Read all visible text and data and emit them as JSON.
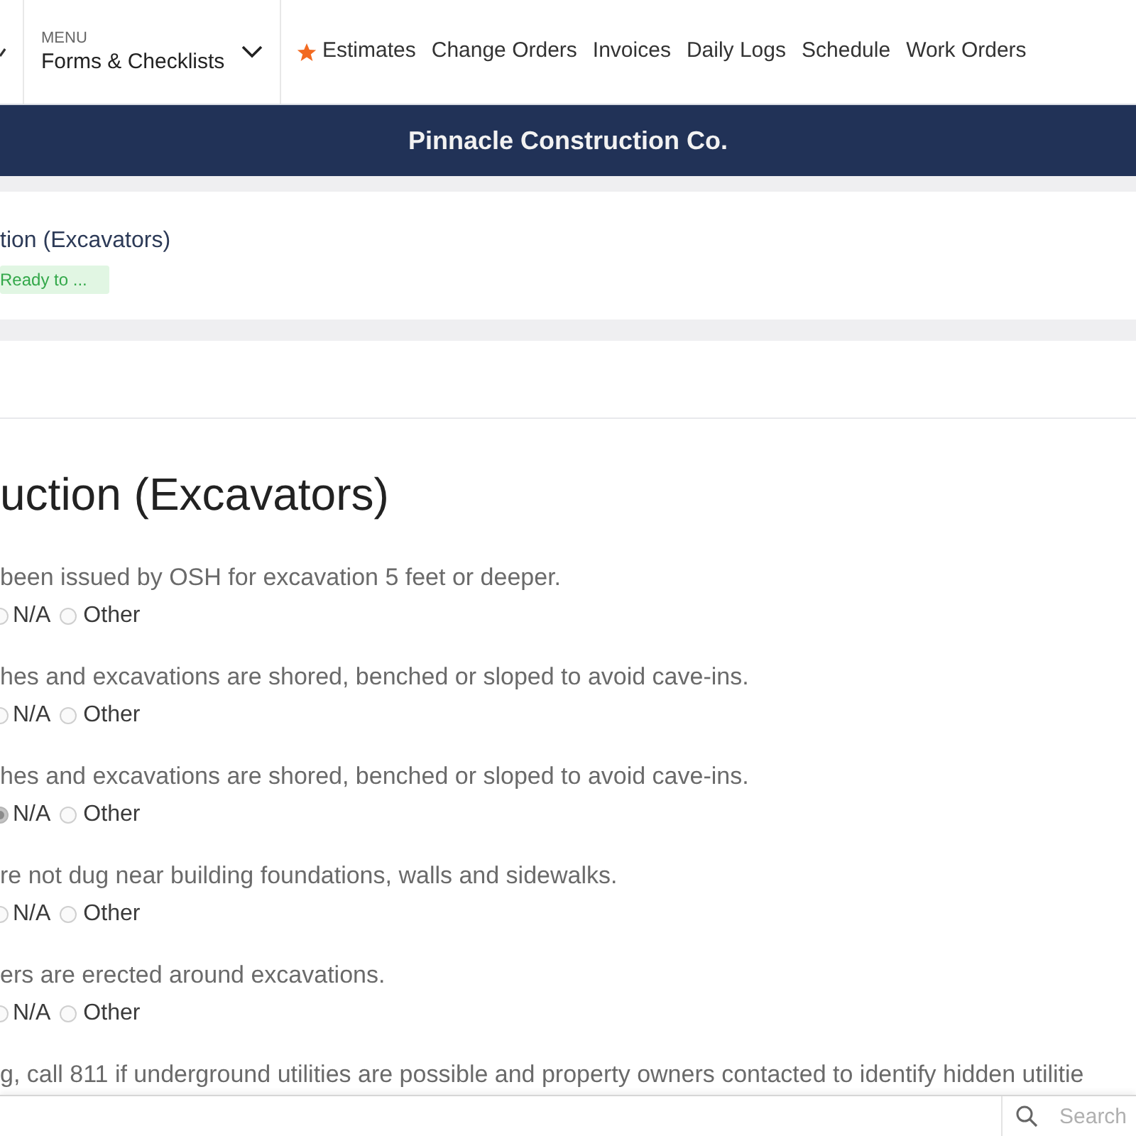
{
  "nav": {
    "menu": {
      "caption": "MENU",
      "value": "Forms & Checklists"
    },
    "links": [
      {
        "label": "Estimates",
        "starred": true
      },
      {
        "label": "Change Orders",
        "starred": false
      },
      {
        "label": "Invoices",
        "starred": false
      },
      {
        "label": "Daily Logs",
        "starred": false
      },
      {
        "label": "Schedule",
        "starred": false
      },
      {
        "label": "Work Orders",
        "starred": false
      }
    ]
  },
  "banner": {
    "title": "Pinnacle Construction Co."
  },
  "record": {
    "title": "tion (Excavators)",
    "status": "Ready to ..."
  },
  "form": {
    "title": "uction (Excavators)",
    "questions": [
      {
        "text": "been issued by OSH for excavation 5 feet or deeper.",
        "options": [
          {
            "label": "N/A",
            "selected": false
          },
          {
            "label": "Other",
            "selected": false
          }
        ]
      },
      {
        "text": "hes and excavations are shored, benched or sloped to avoid cave-ins.",
        "options": [
          {
            "label": "N/A",
            "selected": false
          },
          {
            "label": "Other",
            "selected": false
          }
        ]
      },
      {
        "text": "hes and excavations are shored, benched or sloped to avoid cave-ins.",
        "options": [
          {
            "label": "N/A",
            "selected": true
          },
          {
            "label": "Other",
            "selected": false
          }
        ]
      },
      {
        "text": "re not dug near building foundations, walls and sidewalks.",
        "options": [
          {
            "label": "N/A",
            "selected": false
          },
          {
            "label": "Other",
            "selected": false
          }
        ]
      },
      {
        "text": "ers are erected around excavations.",
        "options": [
          {
            "label": "N/A",
            "selected": false
          },
          {
            "label": "Other",
            "selected": false
          }
        ]
      },
      {
        "text": "g, call 811 if underground utilities are possible and property owners contacted to identify hidden utilitie"
      }
    ]
  },
  "search": {
    "placeholder": "Search"
  }
}
